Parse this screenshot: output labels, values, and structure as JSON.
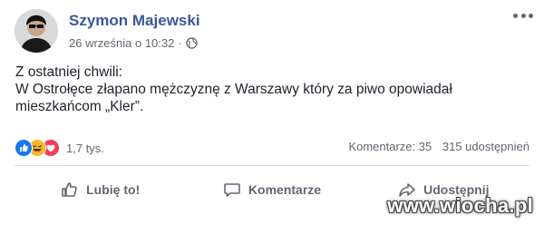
{
  "post": {
    "author": "Szymon Majewski",
    "timestamp": "26 września o 10:32",
    "separator": "·",
    "privacy_icon": "globe-icon",
    "body_lines": [
      "Z ostatniej chwili:",
      "W Ostrołęce złapano mężczyznę z Warszawy który za piwo opowiadał",
      "mieszkańcom „Kler”."
    ],
    "reactions": {
      "icons": [
        "like-reaction-icon",
        "haha-reaction-icon",
        "love-reaction-icon"
      ],
      "count": "1,7 tys."
    },
    "stats": {
      "comments": "Komentarze: 35",
      "shares": "315 udostępnień"
    },
    "actions": {
      "like_label": "Lubię to!",
      "comment_label": "Komentarze",
      "share_label": "Udostępnij"
    }
  },
  "watermark": "www.wiocha.pl",
  "colors": {
    "author": "#385898",
    "meta": "#616770",
    "like": "#1877f2",
    "haha": "#f7b928",
    "love": "#f33e58"
  }
}
